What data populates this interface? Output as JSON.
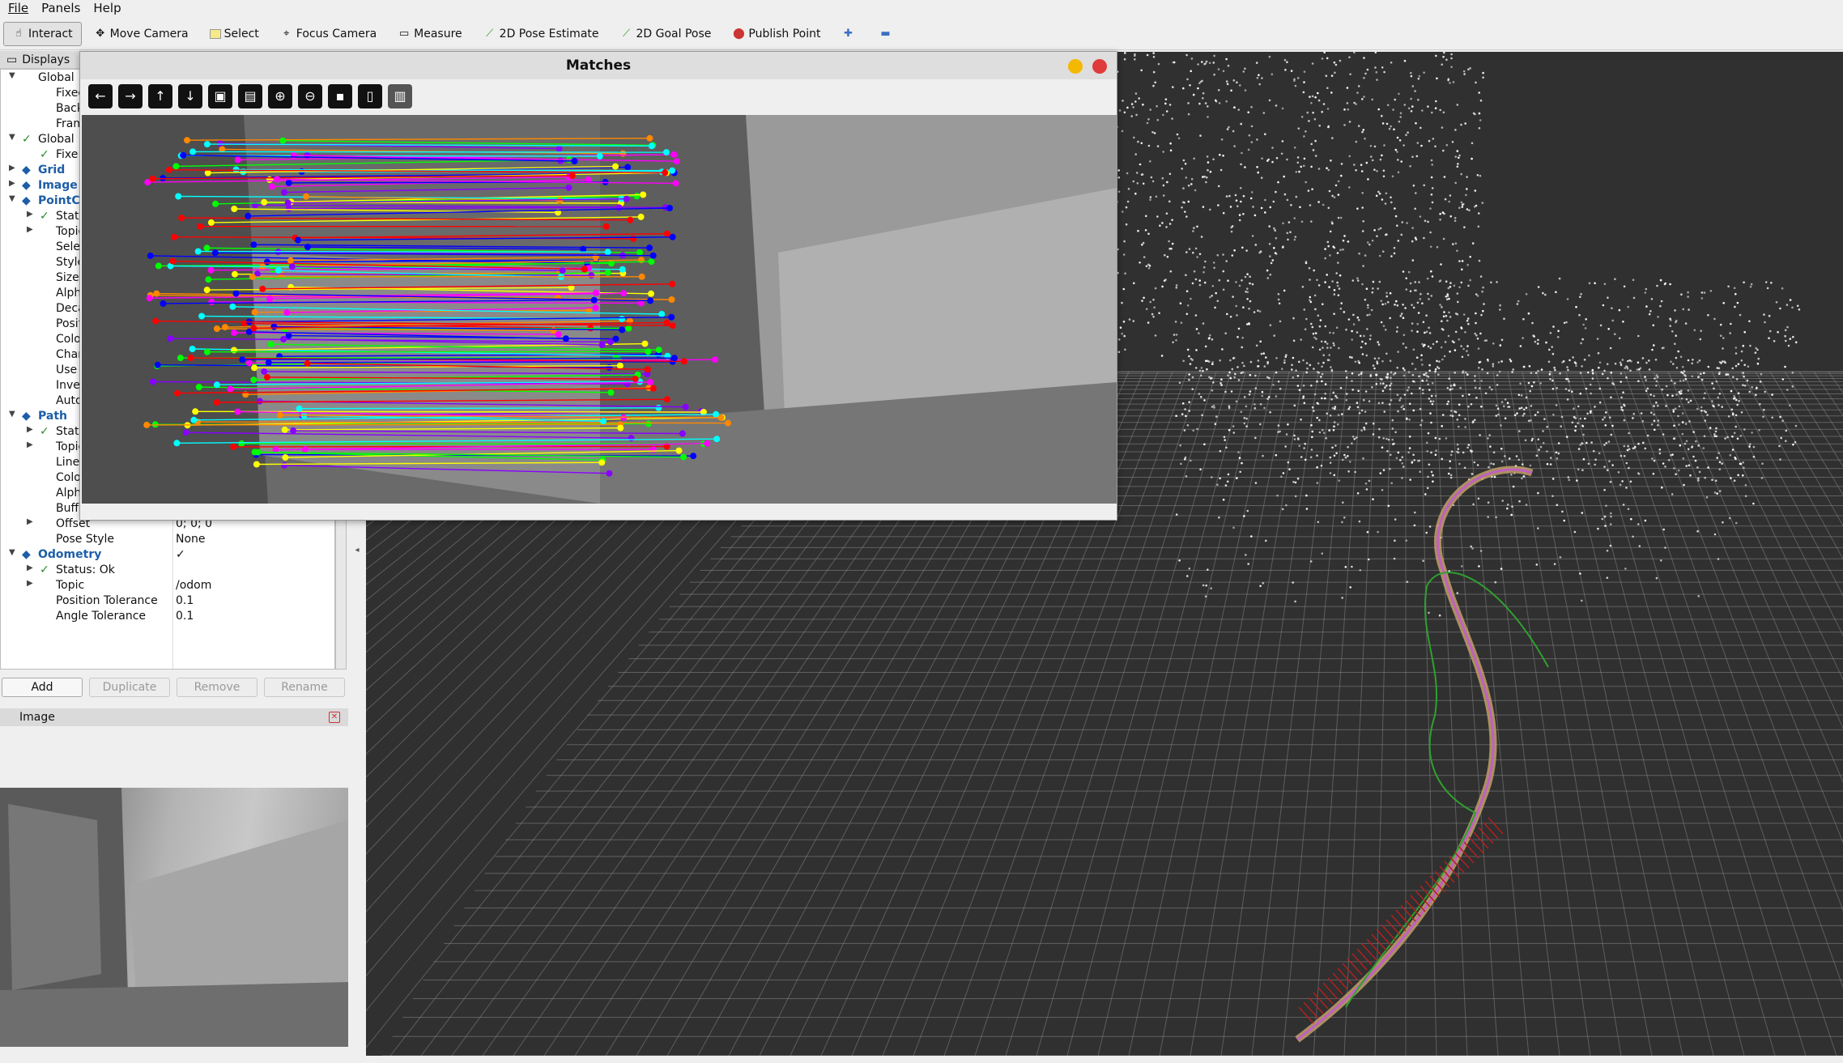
{
  "menu": [
    "File",
    "Panels",
    "Help"
  ],
  "toolbar": {
    "tools": [
      {
        "label": "Interact",
        "icon": "cursor-hand-icon"
      },
      {
        "label": "Move Camera",
        "icon": "move-camera-icon"
      },
      {
        "label": "Select",
        "icon": "select-box-icon"
      },
      {
        "label": "Focus Camera",
        "icon": "focus-camera-icon"
      },
      {
        "label": "Measure",
        "icon": "ruler-icon"
      },
      {
        "label": "2D Pose Estimate",
        "icon": "pose-arrow-icon"
      },
      {
        "label": "2D Goal Pose",
        "icon": "goal-arrow-icon"
      },
      {
        "label": "Publish Point",
        "icon": "map-pin-icon"
      }
    ]
  },
  "displays": {
    "title": "Displays",
    "rows": [
      {
        "key": "Global",
        "val": "",
        "indent": 0,
        "arrow": "down",
        "icon": "gear-icon",
        "blue": false
      },
      {
        "key": "Fixed F",
        "val": "",
        "indent": 1
      },
      {
        "key": "Backgr",
        "val": "",
        "indent": 1
      },
      {
        "key": "Frame",
        "val": "",
        "indent": 1
      },
      {
        "key": "Global",
        "val": "",
        "indent": 0,
        "arrow": "down",
        "check": true
      },
      {
        "key": "Fixe",
        "val": "",
        "indent": 1,
        "check": true
      },
      {
        "key": "Grid",
        "val": "",
        "indent": 0,
        "arrow": "right",
        "blue": true
      },
      {
        "key": "Image",
        "val": "",
        "indent": 0,
        "arrow": "right",
        "blue": true
      },
      {
        "key": "PointC",
        "val": "",
        "indent": 0,
        "arrow": "down",
        "blue": true
      },
      {
        "key": "Stat",
        "val": "",
        "indent": 1,
        "arrow": "right",
        "check": true
      },
      {
        "key": "Topic",
        "val": "",
        "indent": 1,
        "arrow": "right"
      },
      {
        "key": "Selecta",
        "val": "",
        "indent": 1
      },
      {
        "key": "Style",
        "val": "",
        "indent": 1
      },
      {
        "key": "Size (m",
        "val": "",
        "indent": 1
      },
      {
        "key": "Alpha",
        "val": "",
        "indent": 1
      },
      {
        "key": "Decay",
        "val": "",
        "indent": 1
      },
      {
        "key": "Position",
        "val": "",
        "indent": 1
      },
      {
        "key": "Color T",
        "val": "",
        "indent": 1
      },
      {
        "key": "Channe",
        "val": "",
        "indent": 1
      },
      {
        "key": "Use rai",
        "val": "",
        "indent": 1
      },
      {
        "key": "Invert F",
        "val": "",
        "indent": 1
      },
      {
        "key": "Autoco",
        "val": "",
        "indent": 1
      },
      {
        "key": "Path",
        "val": "",
        "indent": 0,
        "arrow": "down",
        "blue": true
      },
      {
        "key": "Stat",
        "val": "",
        "indent": 1,
        "arrow": "right",
        "check": true
      },
      {
        "key": "Topic",
        "val": "",
        "indent": 1,
        "arrow": "right"
      },
      {
        "key": "Line Sty",
        "val": "",
        "indent": 1
      },
      {
        "key": "Color",
        "val": "",
        "indent": 1
      },
      {
        "key": "Alpha",
        "val": "",
        "indent": 1
      },
      {
        "key": "Buffer L",
        "val": "",
        "indent": 1
      },
      {
        "key": "Offset",
        "val": "0; 0; 0",
        "indent": 1,
        "arrow": "right"
      },
      {
        "key": "Pose Style",
        "val": "None",
        "indent": 1
      },
      {
        "key": "Odometry",
        "val": "✓",
        "indent": 0,
        "arrow": "down",
        "blue": true
      },
      {
        "key": "Status: Ok",
        "val": "",
        "indent": 1,
        "arrow": "right",
        "check": true
      },
      {
        "key": "Topic",
        "val": "/odom",
        "indent": 1,
        "arrow": "right"
      },
      {
        "key": "Position Tolerance",
        "val": "0.1",
        "indent": 1
      },
      {
        "key": "Angle Tolerance",
        "val": "0.1",
        "indent": 1
      }
    ]
  },
  "buttons": {
    "add": "Add",
    "duplicate": "Duplicate",
    "remove": "Remove",
    "rename": "Rename"
  },
  "image_panel": {
    "title": "Image"
  },
  "matches_window": {
    "title": "Matches"
  }
}
